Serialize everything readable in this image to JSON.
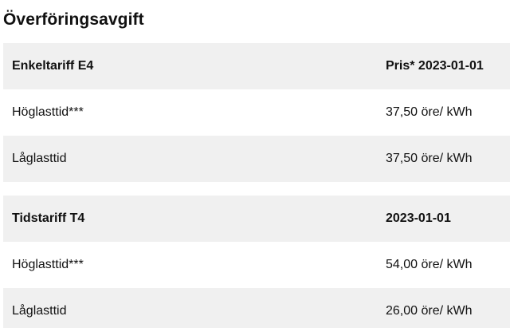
{
  "title": "Överföringsavgift",
  "tables": [
    {
      "header": {
        "name": "Enkeltariff E4",
        "price_label": "Pris* 2023-01-01"
      },
      "rows": [
        {
          "label": "Höglasttid***",
          "value": "37,50 öre/ kWh"
        },
        {
          "label": "Låglasttid",
          "value": "37,50 öre/ kWh"
        }
      ]
    },
    {
      "header": {
        "name": "Tidstariff T4",
        "price_label": "2023-01-01"
      },
      "rows": [
        {
          "label": "Höglasttid***",
          "value": "54,00 öre/ kWh"
        },
        {
          "label": "Låglasttid",
          "value": "26,00 öre/ kWh"
        }
      ]
    }
  ],
  "colors": {
    "row_shade": "#f0f0f0",
    "text": "#111111",
    "background": "#ffffff"
  }
}
